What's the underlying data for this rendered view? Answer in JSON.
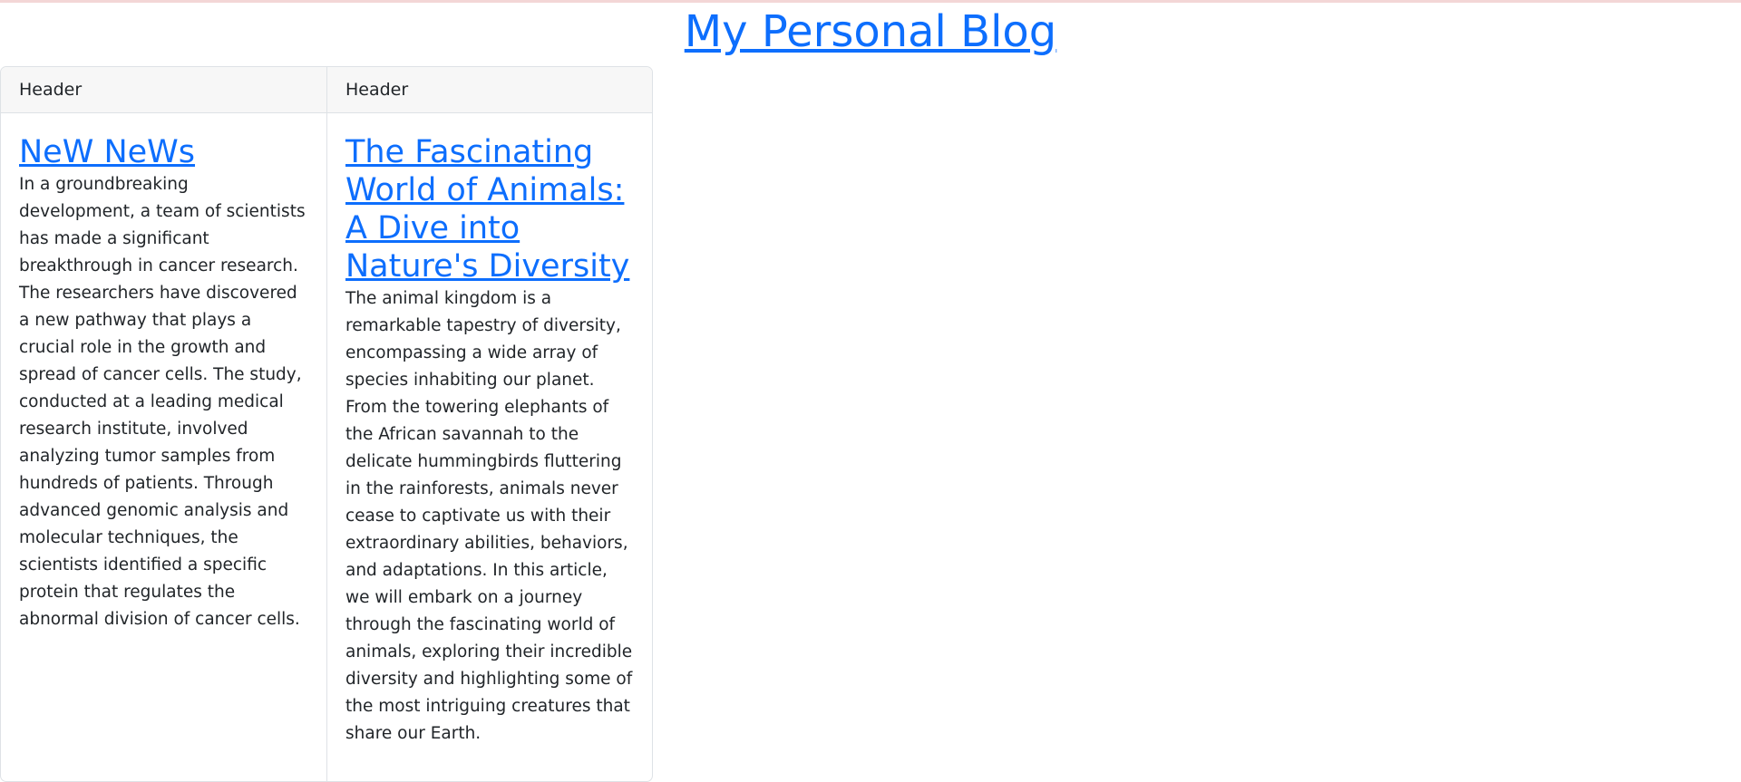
{
  "site": {
    "title": "My Personal Blog"
  },
  "posts": [
    {
      "header": "Header",
      "title": "NeW NeWs",
      "body": "In a groundbreaking development, a team of scientists has made a significant breakthrough in cancer research. The researchers have discovered a new pathway that plays a crucial role in the growth and spread of cancer cells. The study, conducted at a leading medical research institute, involved analyzing tumor samples from hundreds of patients. Through advanced genomic analysis and molecular techniques, the scientists identified a specific protein that regulates the abnormal division of cancer cells."
    },
    {
      "header": "Header",
      "title": "The Fascinating World of Animals: A Dive into Nature's Diversity",
      "body": "The animal kingdom is a remarkable tapestry of diversity, encompassing a wide array of species inhabiting our planet. From the towering elephants of the African savannah to the delicate hummingbirds fluttering in the rainforests, animals never cease to captivate us with their extraordinary abilities, behaviors, and adaptations. In this article, we will embark on a journey through the fascinating world of animals, exploring their incredible diversity and highlighting some of the most intriguing creatures that share our Earth."
    }
  ],
  "colors": {
    "link": "#0d6efd",
    "text": "#212529",
    "header_bg": "#f7f7f7",
    "border": "#dee2e6"
  }
}
